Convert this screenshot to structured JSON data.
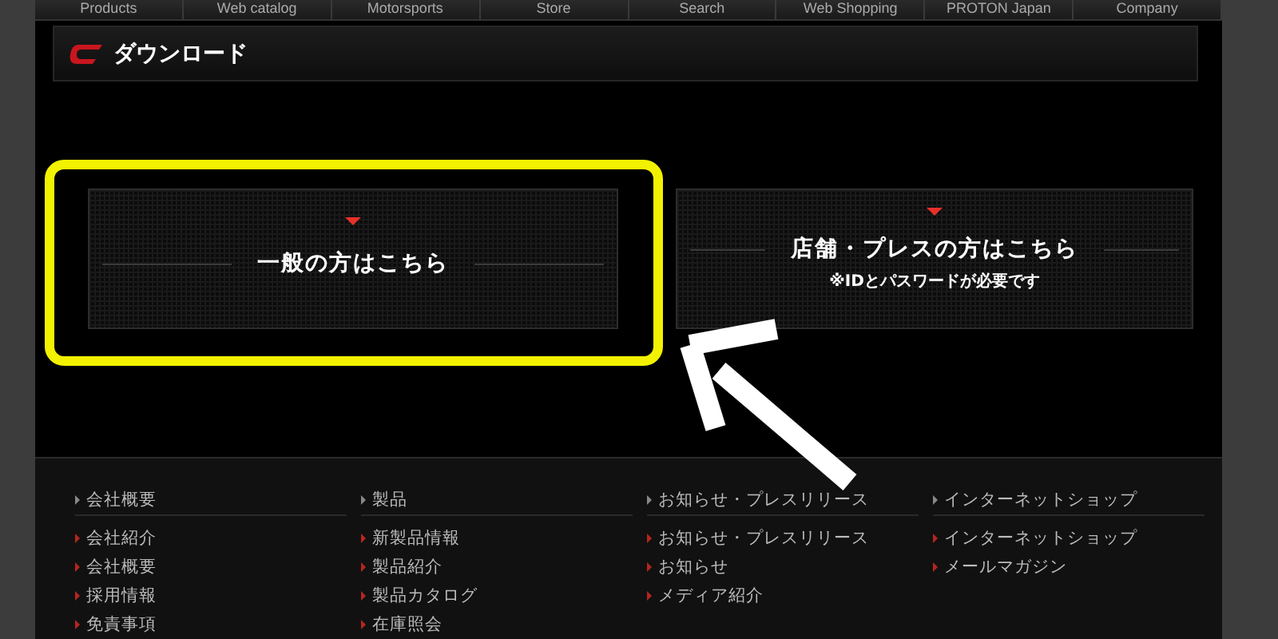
{
  "nav": {
    "items": [
      "Products",
      "Web catalog",
      "Motorsports",
      "Store",
      "Search",
      "Web Shopping",
      "PROTON Japan",
      "Company"
    ]
  },
  "header": {
    "title": "ダウンロード"
  },
  "cards": [
    {
      "title": "一般の方はこちら",
      "highlighted": true
    },
    {
      "title": "店舗・プレスの方はこちら",
      "note": "※IDとパスワードが必要です",
      "highlighted": false
    }
  ],
  "footer": {
    "columns": [
      {
        "heading": "会社概要",
        "items": [
          "会社紹介",
          "会社概要",
          "採用情報",
          "免責事項"
        ]
      },
      {
        "heading": "製品",
        "items": [
          "新製品情報",
          "製品紹介",
          "製品カタログ",
          "在庫照会"
        ]
      },
      {
        "heading": "お知らせ・プレスリリース",
        "items": [
          "お知らせ・プレスリリース",
          "お知らせ",
          "メディア紹介"
        ]
      },
      {
        "heading": "インターネットショップ",
        "items": [
          "インターネットショップ",
          "メールマガジン"
        ]
      }
    ]
  }
}
